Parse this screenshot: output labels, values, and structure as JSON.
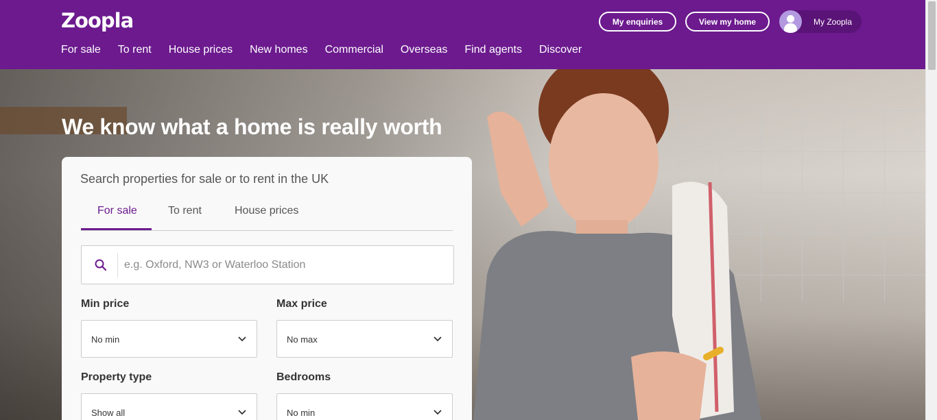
{
  "header": {
    "logo": "Zoopla",
    "nav": [
      "For sale",
      "To rent",
      "House prices",
      "New homes",
      "Commercial",
      "Overseas",
      "Find agents",
      "Discover"
    ],
    "enquiries_label": "My enquiries",
    "view_home_label": "View my home",
    "account_label": "My Zoopla"
  },
  "hero": {
    "title": "We know what a home is really worth"
  },
  "search": {
    "title": "Search properties for sale or to rent in the UK",
    "tabs": [
      "For sale",
      "To rent",
      "House prices"
    ],
    "active_tab": "For sale",
    "placeholder": "e.g. Oxford, NW3 or Waterloo Station",
    "min_price_label": "Min price",
    "min_price_value": "No min",
    "max_price_label": "Max price",
    "max_price_value": "No max",
    "property_type_label": "Property type",
    "property_type_value": "Show all",
    "bedrooms_label": "Bedrooms",
    "bedrooms_value": "No min"
  },
  "colors": {
    "brand": "#6c1a8e"
  }
}
